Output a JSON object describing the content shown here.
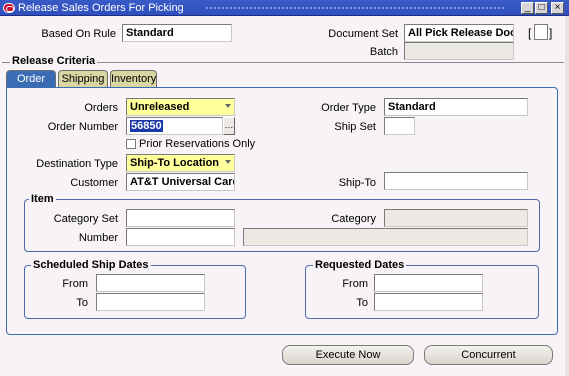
{
  "window": {
    "title": "Release Sales Orders For Picking",
    "minimize_glyph": "_",
    "maximize_glyph": "□",
    "close_glyph": "×"
  },
  "header": {
    "based_on_rule_label": "Based On Rule",
    "based_on_rule_value": "Standard",
    "document_set_label": "Document Set",
    "document_set_value": "All Pick Release Docu",
    "batch_label": "Batch",
    "batch_value": "",
    "bracket_open": "[",
    "bracket_close": "]"
  },
  "release_criteria": {
    "section_title": "Release Criteria",
    "tabs": [
      {
        "label": "Order",
        "active": true
      },
      {
        "label": "Shipping",
        "active": false
      },
      {
        "label": "Inventory",
        "active": false
      }
    ],
    "orders_label": "Orders",
    "orders_value": "Unreleased",
    "order_type_label": "Order Type",
    "order_type_value": "Standard",
    "order_number_label": "Order Number",
    "order_number_value": "56850",
    "lov_glyph": "…",
    "ship_set_label": "Ship Set",
    "ship_set_value": "",
    "prior_reservations_label": "Prior Reservations Only",
    "prior_reservations_checked": false,
    "destination_type_label": "Destination Type",
    "destination_type_value": "Ship-To Location",
    "customer_label": "Customer",
    "customer_value": "AT&T Universal Card",
    "ship_to_label": "Ship-To",
    "ship_to_value": ""
  },
  "item": {
    "title": "Item",
    "category_set_label": "Category Set",
    "category_set_value": "",
    "category_label": "Category",
    "category_value": "",
    "number_label": "Number",
    "number_value": "",
    "description_value": ""
  },
  "scheduled_ship_dates": {
    "title": "Scheduled Ship Dates",
    "from_label": "From",
    "from_value": "",
    "to_label": "To",
    "to_value": ""
  },
  "requested_dates": {
    "title": "Requested Dates",
    "from_label": "From",
    "from_value": "",
    "to_label": "To",
    "to_value": ""
  },
  "buttons": {
    "execute_now": "Execute Now",
    "concurrent": "Concurrent"
  },
  "colors": {
    "title_bar": "#2f4fbd",
    "active_tab": "#3a6cb4",
    "inactive_tab": "#d9d6a4",
    "required_field": "#ffff9c",
    "selection": "#1a38a8"
  }
}
